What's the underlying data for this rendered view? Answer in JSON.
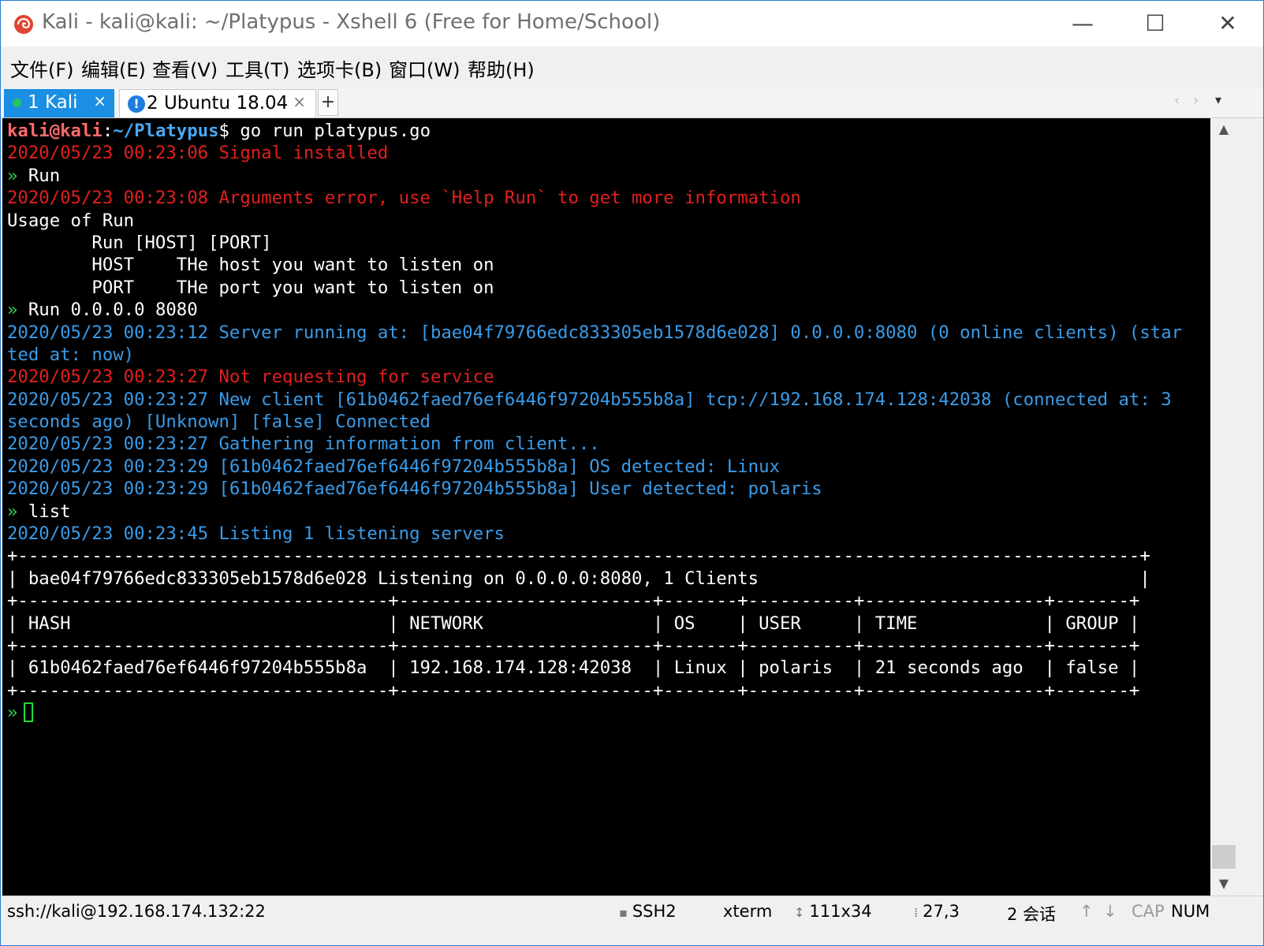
{
  "window": {
    "title": "Kali - kali@kali: ~/Platypus - Xshell 6 (Free for Home/School)",
    "controls": {
      "minimize": "—",
      "maximize": "☐",
      "close": "✕"
    }
  },
  "menu": [
    "文件(F)",
    "编辑(E)",
    "查看(V)",
    "工具(T)",
    "选项卡(B)",
    "窗口(W)",
    "帮助(H)"
  ],
  "tabs": [
    {
      "label": "1 Kali",
      "active": true,
      "close": "×"
    },
    {
      "label": "2 Ubuntu 18.04",
      "active": false,
      "alert": "!",
      "close": "×"
    }
  ],
  "tab_add": "+",
  "tab_nav": {
    "prev": "‹",
    "next": "›",
    "menu": "▾"
  },
  "colors": {
    "terminal_bg": "#000000",
    "error": "#e0201e",
    "info": "#3a9be8",
    "prompt_arrow": "#33d24a",
    "active_tab": "#1a8fe3"
  },
  "terminal": {
    "prompt_user": "kali@kali",
    "prompt_sep": ":",
    "prompt_path": "~/Platypus",
    "prompt_symbol": "$",
    "command": " go run platypus.go",
    "lines": [
      {
        "color": "red",
        "text": "2020/05/23 00:23:06 Signal installed"
      },
      {
        "color": "white",
        "arrow": true,
        "text": " Run"
      },
      {
        "color": "red",
        "text": "2020/05/23 00:23:08 Arguments error, use `Help Run` to get more information"
      },
      {
        "color": "white",
        "text": "Usage of Run"
      },
      {
        "color": "white",
        "text": "        Run [HOST] [PORT]"
      },
      {
        "color": "white",
        "text": "        HOST    THe host you want to listen on"
      },
      {
        "color": "white",
        "text": "        PORT    THe port you want to listen on"
      },
      {
        "color": "white",
        "arrow": true,
        "text": " Run 0.0.0.0 8080"
      },
      {
        "color": "blue",
        "text": "2020/05/23 00:23:12 Server running at: [bae04f79766edc833305eb1578d6e028] 0.0.0.0:8080 (0 online clients) (star"
      },
      {
        "color": "blue",
        "text": "ted at: now)"
      },
      {
        "color": "red",
        "text": "2020/05/23 00:23:27 Not requesting for service"
      },
      {
        "color": "blue",
        "text": "2020/05/23 00:23:27 New client [61b0462faed76ef6446f97204b555b8a] tcp://192.168.174.128:42038 (connected at: 3"
      },
      {
        "color": "blue",
        "text": "seconds ago) [Unknown] [false] Connected"
      },
      {
        "color": "blue",
        "text": "2020/05/23 00:23:27 Gathering information from client..."
      },
      {
        "color": "blue",
        "text": "2020/05/23 00:23:29 [61b0462faed76ef6446f97204b555b8a] OS detected: Linux"
      },
      {
        "color": "blue",
        "text": "2020/05/23 00:23:29 [61b0462faed76ef6446f97204b555b8a] User detected: polaris"
      },
      {
        "color": "white",
        "arrow": true,
        "text": " list"
      },
      {
        "color": "blue",
        "text": "2020/05/23 00:23:45 Listing 1 listening servers"
      },
      {
        "color": "white",
        "text": "+----------------------------------------------------------------------------------------------------------+"
      },
      {
        "color": "white",
        "text": "| bae04f79766edc833305eb1578d6e028 Listening on 0.0.0.0:8080, 1 Clients                                    |"
      },
      {
        "color": "white",
        "text": "+-----------------------------------+------------------------+-------+----------+-----------------+-------+"
      },
      {
        "color": "white",
        "text": "| HASH                              | NETWORK                | OS    | USER     | TIME            | GROUP |"
      },
      {
        "color": "white",
        "text": "+-----------------------------------+------------------------+-------+----------+-----------------+-------+"
      },
      {
        "color": "white",
        "text": "| 61b0462faed76ef6446f97204b555b8a  | 192.168.174.128:42038  | Linux | polaris  | 21 seconds ago  | false |"
      },
      {
        "color": "white",
        "text": "+-----------------------------------+------------------------+-------+----------+-----------------+-------+"
      }
    ],
    "arrow_glyph": "»",
    "current_prompt": "»"
  },
  "scrollbar": {
    "up": "▲",
    "down": "▼"
  },
  "status": {
    "connection": "ssh://kali@192.168.174.132:22",
    "protocol": "SSH2",
    "terminal_type": "xterm",
    "size": "111x34",
    "cursor_pos": "27,3",
    "sessions": "2 会话",
    "up_arrow": "↑",
    "down_arrow": "↓",
    "caps": "CAP",
    "num": "NUM"
  }
}
